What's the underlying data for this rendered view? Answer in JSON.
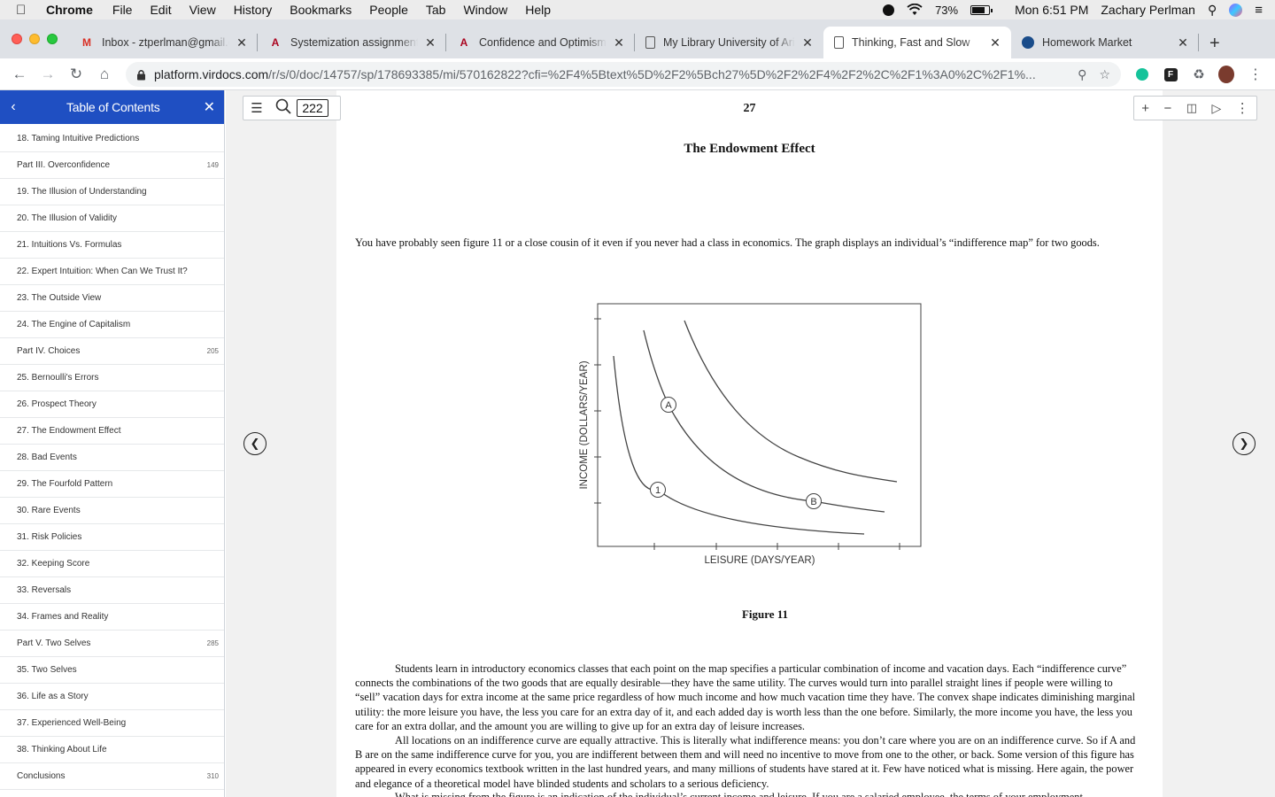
{
  "menubar": {
    "apple": "",
    "items": [
      "Chrome",
      "File",
      "Edit",
      "View",
      "History",
      "Bookmarks",
      "People",
      "Tab",
      "Window",
      "Help"
    ],
    "battery": "73%",
    "clock": "Mon 6:51 PM",
    "user": "Zachary Perlman"
  },
  "tabs": [
    {
      "title": "Inbox - ztperlman@gmail.com",
      "icon": "gmail-icon"
    },
    {
      "title": "Systemization assignment",
      "icon": "arizona-icon"
    },
    {
      "title": "Confidence and Optimism",
      "icon": "arizona-icon"
    },
    {
      "title": "My Library University of Arizona",
      "icon": "document-icon"
    },
    {
      "title": "Thinking, Fast and Slow",
      "icon": "document-icon"
    },
    {
      "title": "Homework Market",
      "icon": "homework-market-icon"
    }
  ],
  "toolbar": {
    "url_host": "platform.virdocs.com",
    "url_path": "/r/s/0/doc/14757/sp/178693385/mi/570162822?cfi=%2F4%5Btext%5D%2F2%5Bch27%5D%2F2%2F4%2F2%2C%2F1%3A0%2C%2F1%..."
  },
  "sidebar": {
    "title": "Table of Contents",
    "items": [
      {
        "label": "18. Taming Intuitive Predictions",
        "page": ""
      },
      {
        "label": "Part III. Overconfidence",
        "page": "149"
      },
      {
        "label": "19. The Illusion of Understanding",
        "page": ""
      },
      {
        "label": "20. The Illusion of Validity",
        "page": ""
      },
      {
        "label": "21. Intuitions Vs. Formulas",
        "page": ""
      },
      {
        "label": "22. Expert Intuition: When Can We Trust It?",
        "page": ""
      },
      {
        "label": "23. The Outside View",
        "page": ""
      },
      {
        "label": "24. The Engine of Capitalism",
        "page": ""
      },
      {
        "label": "Part IV. Choices",
        "page": "205"
      },
      {
        "label": "25. Bernoulli's Errors",
        "page": ""
      },
      {
        "label": "26. Prospect Theory",
        "page": ""
      },
      {
        "label": "27. The Endowment Effect",
        "page": ""
      },
      {
        "label": "28. Bad Events",
        "page": ""
      },
      {
        "label": "29. The Fourfold Pattern",
        "page": ""
      },
      {
        "label": "30. Rare Events",
        "page": ""
      },
      {
        "label": "31. Risk Policies",
        "page": ""
      },
      {
        "label": "32. Keeping Score",
        "page": ""
      },
      {
        "label": "33. Reversals",
        "page": ""
      },
      {
        "label": "34. Frames and Reality",
        "page": ""
      },
      {
        "label": "Part V. Two Selves",
        "page": "285"
      },
      {
        "label": "35. Two Selves",
        "page": ""
      },
      {
        "label": "36. Life as a Story",
        "page": ""
      },
      {
        "label": "37. Experienced Well-Being",
        "page": ""
      },
      {
        "label": "38. Thinking About Life",
        "page": ""
      },
      {
        "label": "Conclusions",
        "page": "310"
      }
    ]
  },
  "reader": {
    "page_input": "222",
    "page_number": "27",
    "chapter_title": "The Endowment Effect",
    "intro": "You have probably seen figure 11 or a close cousin of it even if you never had a class in economics. The graph displays an individual’s “indifference map” for two goods.",
    "figure_caption": "Figure 11",
    "para1": "Students learn in introductory economics classes that each point on the map specifies a particular combination of income and vacation days. Each “indifference curve” connects the combinations of the two goods that are equally desirable—they have the same utility. The curves would turn into parallel straight lines if people were willing to “sell” vacation days for extra income at the same price regardless of how much income and how much vacation time they have. The convex shape indicates diminishing marginal utility: the more leisure you have, the less you care for an extra day of it, and each added day is worth less than the one before. Similarly, the more income you have, the less you care for an extra dollar, and the amount you are willing to give up for an extra day of leisure increases.",
    "para2": "All locations on an indifference curve are equally attractive. This is literally what indifference means: you don’t care where you are on an indifference curve. So if A and B are on the same indifference curve for you, you are indifferent between them and will need no incentive to move from one to the other, or back. Some version of this figure has appeared in every economics textbook written in the last hundred years, and many millions of students have stared at it. Few have noticed what is missing. Here again, the power and elegance of a theoretical model have blinded students and scholars to a serious deficiency.",
    "para3": "What is missing from the figure is an indication of the individual’s current income and leisure. If you are a salaried employee, the terms of your employment"
  },
  "figure": {
    "xlabel": "LEISURE (DAYS/YEAR)",
    "ylabel": "INCOME (DOLLARS/YEAR)",
    "point_labels": [
      "A",
      "B",
      "1"
    ]
  }
}
